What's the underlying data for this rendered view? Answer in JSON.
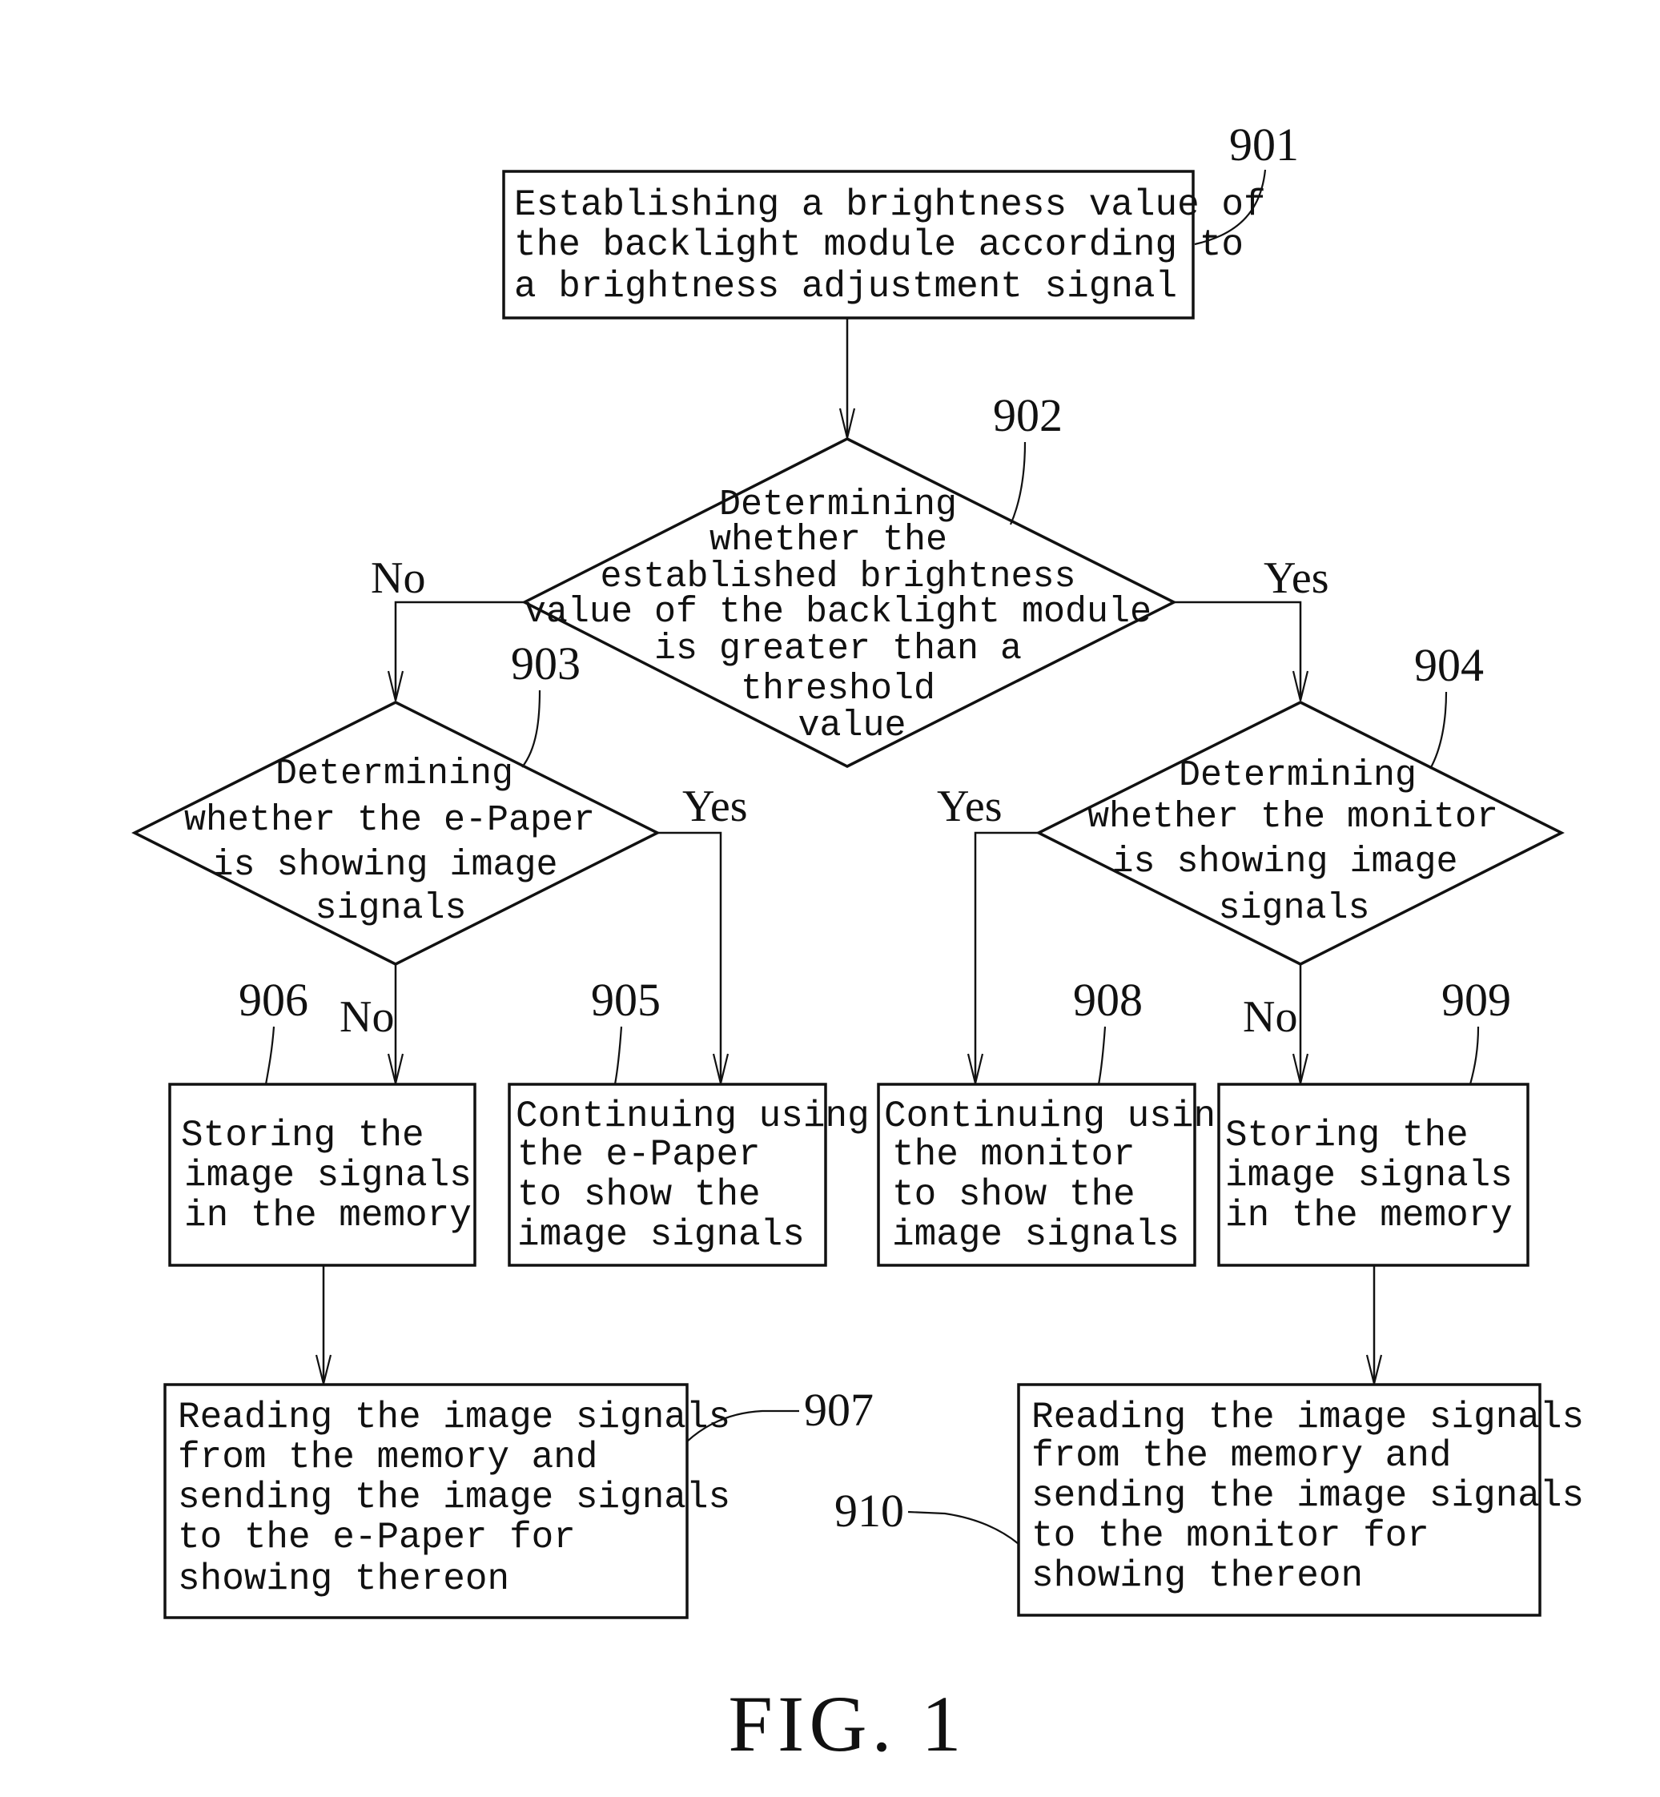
{
  "figure_title": "FIG. 1",
  "steps": {
    "s901": {
      "ref": "901",
      "type": "process",
      "lines": [
        "Establishing a brightness value of",
        "the backlight module according to",
        "a brightness adjustment signal"
      ]
    },
    "s902": {
      "ref": "902",
      "type": "decision",
      "lines": [
        "Determining",
        "whether the",
        "established brightness",
        "value of the backlight module",
        "is greater than a",
        "threshold",
        "value"
      ]
    },
    "s903": {
      "ref": "903",
      "type": "decision",
      "lines": [
        "Determining",
        "whether the e-Paper",
        "is showing image",
        "signals"
      ]
    },
    "s904": {
      "ref": "904",
      "type": "decision",
      "lines": [
        "Determining",
        "whether the monitor",
        "is showing image",
        "signals"
      ]
    },
    "s905": {
      "ref": "905",
      "type": "process",
      "lines": [
        "Continuing using",
        "the e-Paper",
        "to show the",
        "image signals"
      ]
    },
    "s906": {
      "ref": "906",
      "type": "process",
      "lines": [
        "Storing the",
        "image signals",
        "in the memory"
      ]
    },
    "s907": {
      "ref": "907",
      "type": "process",
      "lines": [
        "Reading the image signals",
        "from the memory and",
        "sending the image signals",
        "to the e-Paper for",
        "showing thereon"
      ]
    },
    "s908": {
      "ref": "908",
      "type": "process",
      "lines": [
        "Continuing using",
        "the monitor",
        "to show the",
        "image signals"
      ]
    },
    "s909": {
      "ref": "909",
      "type": "process",
      "lines": [
        "Storing the",
        "image signals",
        "in the memory"
      ]
    },
    "s910": {
      "ref": "910",
      "type": "process",
      "lines": [
        "Reading the image signals",
        "from the memory and",
        "sending the image signals",
        "to the monitor for",
        "showing thereon"
      ]
    }
  },
  "branches": {
    "b902_no": "No",
    "b902_yes": "Yes",
    "b903_no": "No",
    "b903_yes": "Yes",
    "b904_no": "No",
    "b904_yes": "Yes"
  },
  "edges": [
    {
      "from": "901",
      "to": "902"
    },
    {
      "from": "902",
      "to": "903",
      "label": "No"
    },
    {
      "from": "902",
      "to": "904",
      "label": "Yes"
    },
    {
      "from": "903",
      "to": "906",
      "label": "No"
    },
    {
      "from": "903",
      "to": "905",
      "label": "Yes"
    },
    {
      "from": "904",
      "to": "909",
      "label": "No"
    },
    {
      "from": "904",
      "to": "908",
      "label": "Yes"
    },
    {
      "from": "906",
      "to": "907"
    },
    {
      "from": "909",
      "to": "910"
    }
  ]
}
